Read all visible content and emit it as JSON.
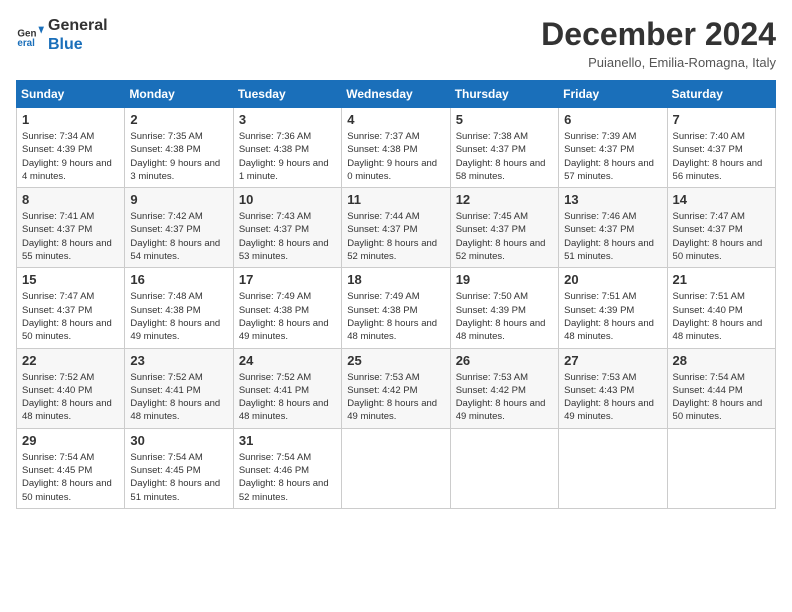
{
  "logo": {
    "line1": "General",
    "line2": "Blue"
  },
  "title": "December 2024",
  "subtitle": "Puianello, Emilia-Romagna, Italy",
  "days_of_week": [
    "Sunday",
    "Monday",
    "Tuesday",
    "Wednesday",
    "Thursday",
    "Friday",
    "Saturday"
  ],
  "weeks": [
    [
      {
        "day": "1",
        "sunrise": "7:34 AM",
        "sunset": "4:39 PM",
        "daylight": "9 hours and 4 minutes."
      },
      {
        "day": "2",
        "sunrise": "7:35 AM",
        "sunset": "4:38 PM",
        "daylight": "9 hours and 3 minutes."
      },
      {
        "day": "3",
        "sunrise": "7:36 AM",
        "sunset": "4:38 PM",
        "daylight": "9 hours and 1 minute."
      },
      {
        "day": "4",
        "sunrise": "7:37 AM",
        "sunset": "4:38 PM",
        "daylight": "9 hours and 0 minutes."
      },
      {
        "day": "5",
        "sunrise": "7:38 AM",
        "sunset": "4:37 PM",
        "daylight": "8 hours and 58 minutes."
      },
      {
        "day": "6",
        "sunrise": "7:39 AM",
        "sunset": "4:37 PM",
        "daylight": "8 hours and 57 minutes."
      },
      {
        "day": "7",
        "sunrise": "7:40 AM",
        "sunset": "4:37 PM",
        "daylight": "8 hours and 56 minutes."
      }
    ],
    [
      {
        "day": "8",
        "sunrise": "7:41 AM",
        "sunset": "4:37 PM",
        "daylight": "8 hours and 55 minutes."
      },
      {
        "day": "9",
        "sunrise": "7:42 AM",
        "sunset": "4:37 PM",
        "daylight": "8 hours and 54 minutes."
      },
      {
        "day": "10",
        "sunrise": "7:43 AM",
        "sunset": "4:37 PM",
        "daylight": "8 hours and 53 minutes."
      },
      {
        "day": "11",
        "sunrise": "7:44 AM",
        "sunset": "4:37 PM",
        "daylight": "8 hours and 52 minutes."
      },
      {
        "day": "12",
        "sunrise": "7:45 AM",
        "sunset": "4:37 PM",
        "daylight": "8 hours and 52 minutes."
      },
      {
        "day": "13",
        "sunrise": "7:46 AM",
        "sunset": "4:37 PM",
        "daylight": "8 hours and 51 minutes."
      },
      {
        "day": "14",
        "sunrise": "7:47 AM",
        "sunset": "4:37 PM",
        "daylight": "8 hours and 50 minutes."
      }
    ],
    [
      {
        "day": "15",
        "sunrise": "7:47 AM",
        "sunset": "4:37 PM",
        "daylight": "8 hours and 50 minutes."
      },
      {
        "day": "16",
        "sunrise": "7:48 AM",
        "sunset": "4:38 PM",
        "daylight": "8 hours and 49 minutes."
      },
      {
        "day": "17",
        "sunrise": "7:49 AM",
        "sunset": "4:38 PM",
        "daylight": "8 hours and 49 minutes."
      },
      {
        "day": "18",
        "sunrise": "7:49 AM",
        "sunset": "4:38 PM",
        "daylight": "8 hours and 48 minutes."
      },
      {
        "day": "19",
        "sunrise": "7:50 AM",
        "sunset": "4:39 PM",
        "daylight": "8 hours and 48 minutes."
      },
      {
        "day": "20",
        "sunrise": "7:51 AM",
        "sunset": "4:39 PM",
        "daylight": "8 hours and 48 minutes."
      },
      {
        "day": "21",
        "sunrise": "7:51 AM",
        "sunset": "4:40 PM",
        "daylight": "8 hours and 48 minutes."
      }
    ],
    [
      {
        "day": "22",
        "sunrise": "7:52 AM",
        "sunset": "4:40 PM",
        "daylight": "8 hours and 48 minutes."
      },
      {
        "day": "23",
        "sunrise": "7:52 AM",
        "sunset": "4:41 PM",
        "daylight": "8 hours and 48 minutes."
      },
      {
        "day": "24",
        "sunrise": "7:52 AM",
        "sunset": "4:41 PM",
        "daylight": "8 hours and 48 minutes."
      },
      {
        "day": "25",
        "sunrise": "7:53 AM",
        "sunset": "4:42 PM",
        "daylight": "8 hours and 49 minutes."
      },
      {
        "day": "26",
        "sunrise": "7:53 AM",
        "sunset": "4:42 PM",
        "daylight": "8 hours and 49 minutes."
      },
      {
        "day": "27",
        "sunrise": "7:53 AM",
        "sunset": "4:43 PM",
        "daylight": "8 hours and 49 minutes."
      },
      {
        "day": "28",
        "sunrise": "7:54 AM",
        "sunset": "4:44 PM",
        "daylight": "8 hours and 50 minutes."
      }
    ],
    [
      {
        "day": "29",
        "sunrise": "7:54 AM",
        "sunset": "4:45 PM",
        "daylight": "8 hours and 50 minutes."
      },
      {
        "day": "30",
        "sunrise": "7:54 AM",
        "sunset": "4:45 PM",
        "daylight": "8 hours and 51 minutes."
      },
      {
        "day": "31",
        "sunrise": "7:54 AM",
        "sunset": "4:46 PM",
        "daylight": "8 hours and 52 minutes."
      },
      null,
      null,
      null,
      null
    ]
  ]
}
